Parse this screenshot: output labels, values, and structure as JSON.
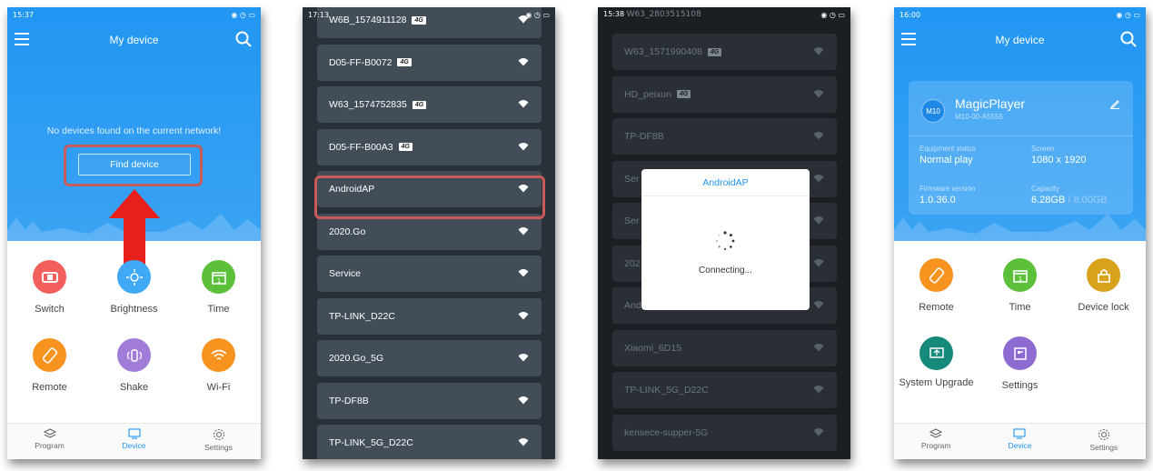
{
  "p1": {
    "status_time": "15:37",
    "title": "My device",
    "empty_message": "No devices found on the current network!",
    "find_button": "Find device",
    "grid": [
      {
        "label": "Switch",
        "icon": "switch-icon",
        "color": "#f25f5c"
      },
      {
        "label": "Brightness",
        "icon": "brightness-icon",
        "color": "#3fa9f5"
      },
      {
        "label": "Time",
        "icon": "calendar-icon",
        "color": "#5cc03a"
      },
      {
        "label": "Remote",
        "icon": "remote-icon",
        "color": "#f7931e"
      },
      {
        "label": "Shake",
        "icon": "shake-icon",
        "color": "#a07bd8"
      },
      {
        "label": "Wi-Fi",
        "icon": "wifi-icon",
        "color": "#f7931e"
      }
    ],
    "tabs": [
      "Program",
      "Device",
      "Settings"
    ]
  },
  "p2": {
    "status_time": "17:13",
    "networks": [
      {
        "name": "W6B_1574911128",
        "tag": "4G"
      },
      {
        "name": "D05-FF-B0072",
        "tag": "4G"
      },
      {
        "name": "W63_1574752835",
        "tag": "4G"
      },
      {
        "name": "D05-FF-B00A3",
        "tag": "4G"
      },
      {
        "name": "AndroidAP",
        "tag": ""
      },
      {
        "name": "2020.Go",
        "tag": ""
      },
      {
        "name": "Service",
        "tag": ""
      },
      {
        "name": "TP-LINK_D22C",
        "tag": ""
      },
      {
        "name": "2020.Go_5G",
        "tag": ""
      },
      {
        "name": "TP-DF8B",
        "tag": ""
      },
      {
        "name": "TP-LINK_5G_D22C",
        "tag": ""
      }
    ]
  },
  "p3": {
    "status_time": "15:38",
    "top_partial": "W63_2803515108",
    "networks": [
      {
        "name": "W63_1571990408",
        "tag": "4G"
      },
      {
        "name": "HD_peixun",
        "tag": "4G"
      },
      {
        "name": "TP-DF8B",
        "tag": ""
      },
      {
        "name": "Ser",
        "tag": ""
      },
      {
        "name": "Ser",
        "tag": ""
      },
      {
        "name": "202",
        "tag": ""
      },
      {
        "name": "And",
        "tag": ""
      },
      {
        "name": "Xiaomi_6D15",
        "tag": ""
      },
      {
        "name": "TP-LINK_5G_D22C",
        "tag": ""
      },
      {
        "name": "kensece-supper-5G",
        "tag": ""
      }
    ],
    "dialog_title": "AndroidAP",
    "dialog_text": "Connecting..."
  },
  "p4": {
    "status_time": "16:00",
    "title": "My device",
    "badge": "M10",
    "device_name": "MagicPlayer",
    "device_id": "M10-00-A5555",
    "equipment_status_label": "Equipment status",
    "equipment_status": "Normal play",
    "screen_label": "Screen",
    "screen": "1080 x 1920",
    "firmware_label": "Firmware version",
    "firmware": "1.0.36.0",
    "capacity_label": "Capacity",
    "capacity_used": "6.28GB",
    "capacity_total": " / 8.00GB",
    "grid": [
      {
        "label": "Remote",
        "icon": "remote-icon",
        "color": "#f7931e"
      },
      {
        "label": "Time",
        "icon": "calendar-icon",
        "color": "#5cc03a"
      },
      {
        "label": "Device lock",
        "icon": "lock-icon",
        "color": "#d9a21b"
      },
      {
        "label": "System Upgrade",
        "icon": "upgrade-icon",
        "color": "#168a7a"
      },
      {
        "label": "Settings",
        "icon": "settings-grid-icon",
        "color": "#8e6bd0"
      }
    ],
    "tabs": [
      "Program",
      "Device",
      "Settings"
    ]
  }
}
